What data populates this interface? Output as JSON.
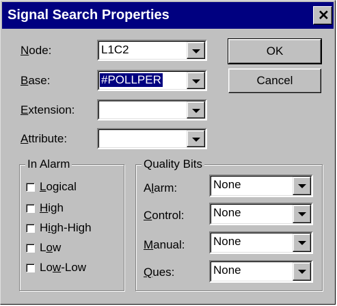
{
  "window": {
    "title": "Signal Search Properties",
    "close_glyph": "✕"
  },
  "fields": {
    "node": {
      "label_u": "N",
      "label_rest": "ode:",
      "value": "L1C2"
    },
    "base": {
      "label_u": "B",
      "label_rest": "ase:",
      "value": "#POLLPER"
    },
    "extension": {
      "label_u": "E",
      "label_rest": "xtension:",
      "value": ""
    },
    "attribute": {
      "label_u": "A",
      "label_rest": "ttribute:",
      "value": ""
    }
  },
  "buttons": {
    "ok": "OK",
    "cancel": "Cancel"
  },
  "in_alarm": {
    "title": "In Alarm",
    "items": [
      {
        "pre": "",
        "u": "L",
        "post": "ogical",
        "checked": false
      },
      {
        "pre": "",
        "u": "H",
        "post": "igh",
        "checked": false
      },
      {
        "pre": "H",
        "u": "i",
        "post": "gh-High",
        "checked": false
      },
      {
        "pre": "L",
        "u": "o",
        "post": "w",
        "checked": false
      },
      {
        "pre": "Lo",
        "u": "w",
        "post": "-Low",
        "checked": false
      }
    ]
  },
  "quality_bits": {
    "title": "Quality Bits",
    "alarm": {
      "pre": "A",
      "u": "l",
      "post": "arm:",
      "value": "None"
    },
    "control": {
      "pre": "",
      "u": "C",
      "post": "ontrol:",
      "value": "None"
    },
    "manual": {
      "pre": "",
      "u": "M",
      "post": "anual:",
      "value": "None"
    },
    "ques": {
      "pre": "",
      "u": "Q",
      "post": "ues:",
      "value": "None"
    }
  }
}
